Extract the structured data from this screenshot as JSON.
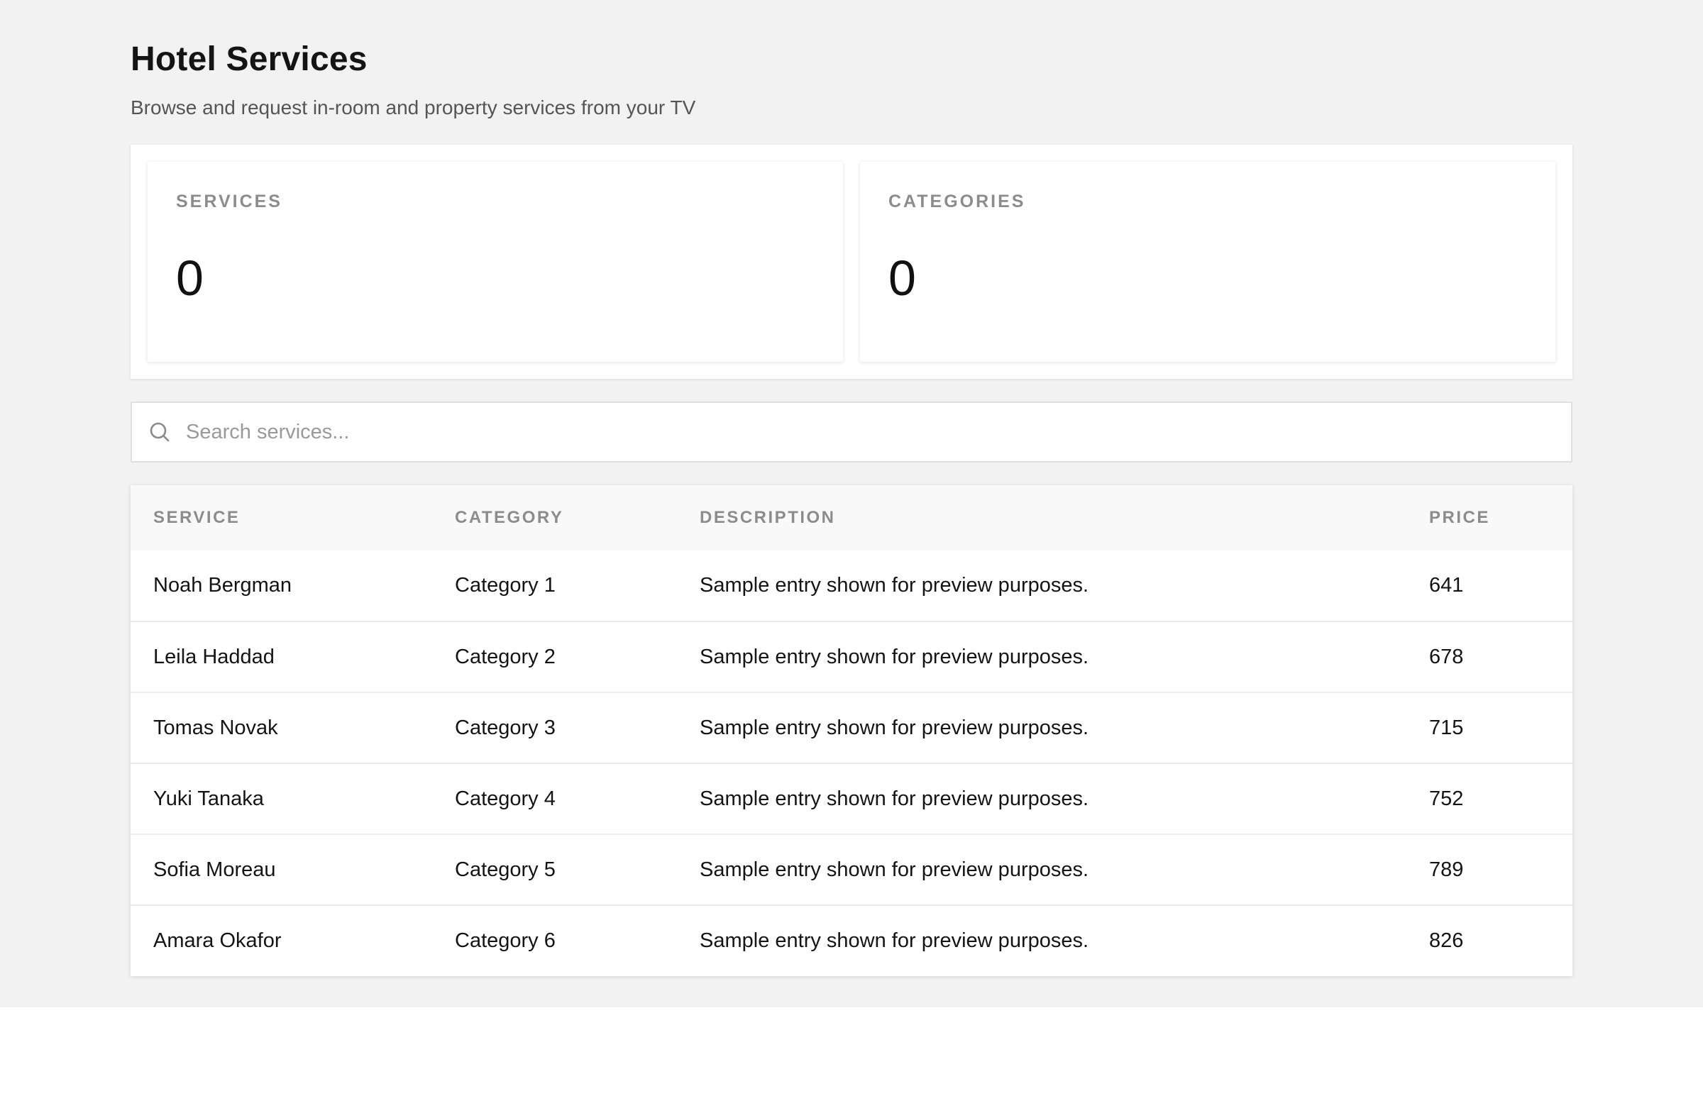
{
  "header": {
    "title": "Hotel Services",
    "subtitle": "Browse and request in-room and property services from your TV"
  },
  "stats": [
    {
      "label": "SERVICES",
      "value": "0"
    },
    {
      "label": "CATEGORIES",
      "value": "0"
    }
  ],
  "search": {
    "placeholder": "Search services...",
    "value": "",
    "icon": "search-icon"
  },
  "table": {
    "columns": [
      "SERVICE",
      "CATEGORY",
      "DESCRIPTION",
      "PRICE"
    ],
    "rows": [
      {
        "service": "Noah Bergman",
        "category": "Category 1",
        "description": "Sample entry shown for preview purposes.",
        "price": "641"
      },
      {
        "service": "Leila Haddad",
        "category": "Category 2",
        "description": "Sample entry shown for preview purposes.",
        "price": "678"
      },
      {
        "service": "Tomas Novak",
        "category": "Category 3",
        "description": "Sample entry shown for preview purposes.",
        "price": "715"
      },
      {
        "service": "Yuki Tanaka",
        "category": "Category 4",
        "description": "Sample entry shown for preview purposes.",
        "price": "752"
      },
      {
        "service": "Sofia Moreau",
        "category": "Category 5",
        "description": "Sample entry shown for preview purposes.",
        "price": "789"
      },
      {
        "service": "Amara Okafor",
        "category": "Category 6",
        "description": "Sample entry shown for preview purposes.",
        "price": "826"
      }
    ]
  },
  "colors": {
    "background": "#f2f2f2",
    "card": "#ffffff",
    "muted_label": "#8c8c8c",
    "text": "#141414"
  }
}
